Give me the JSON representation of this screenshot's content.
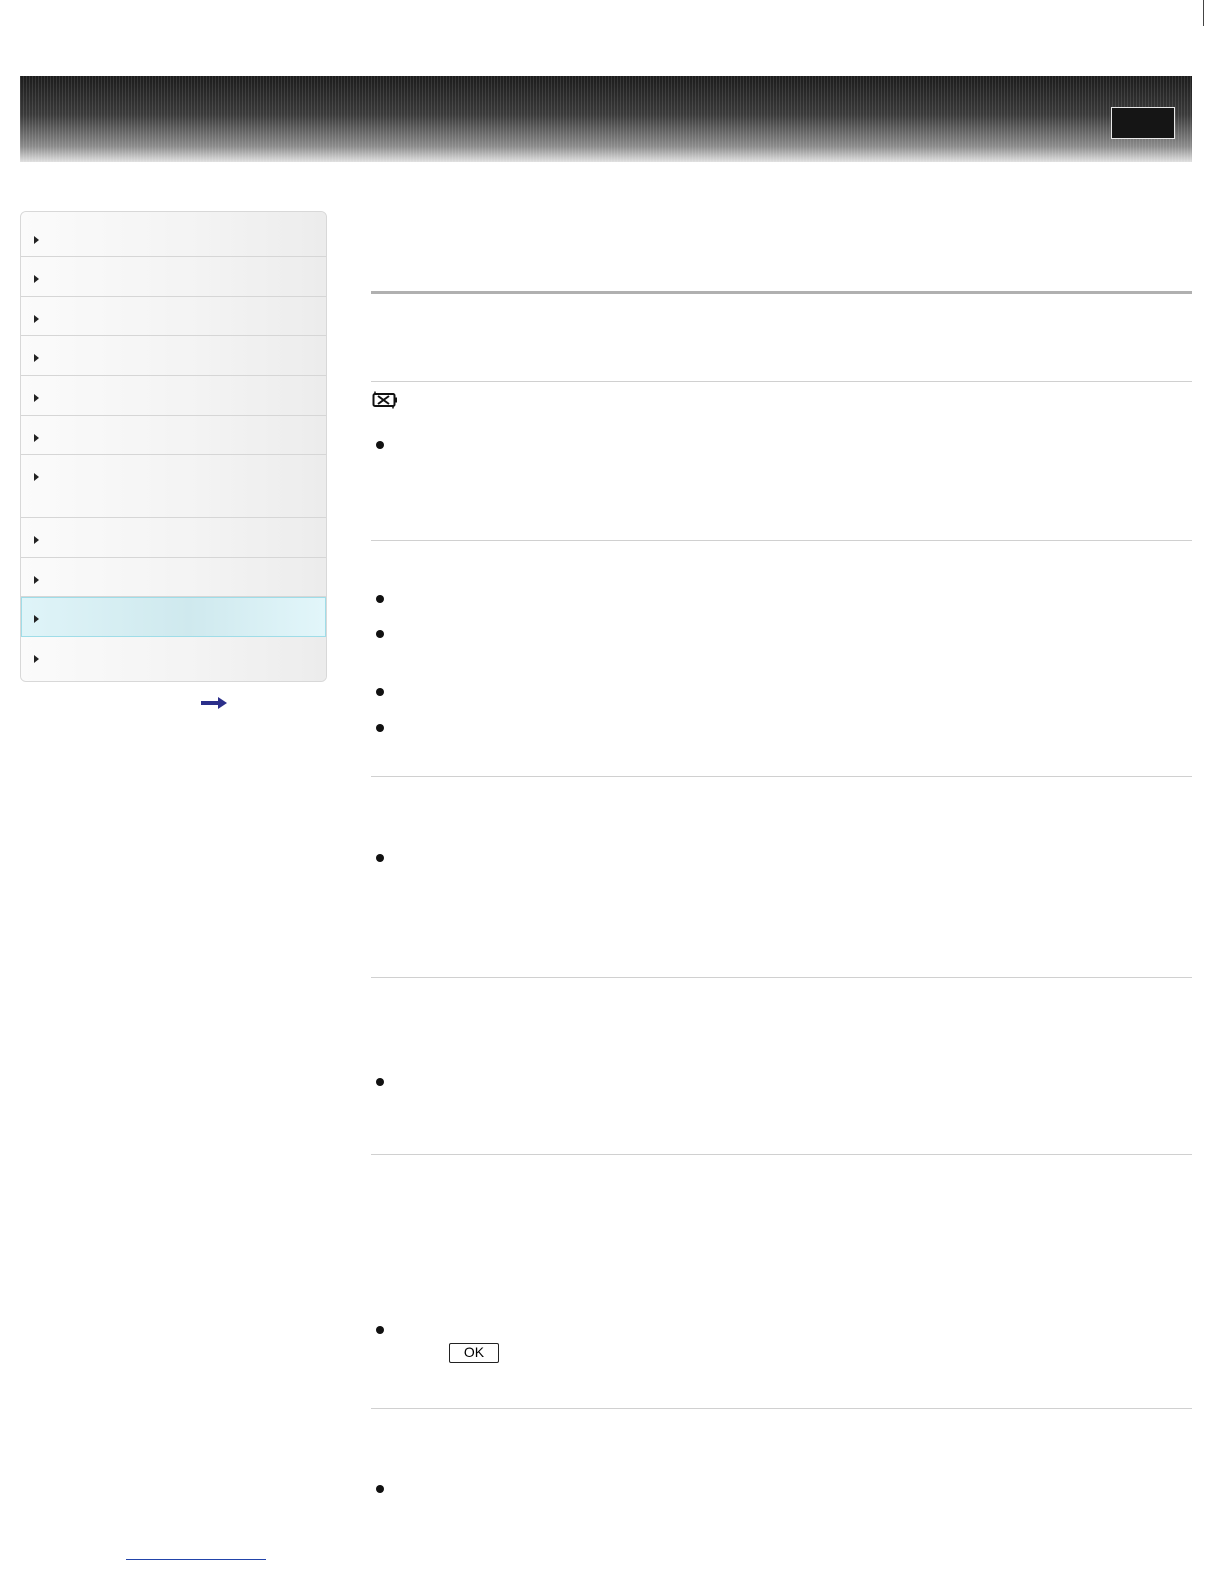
{
  "header": {
    "title": "",
    "top_button_label": ""
  },
  "sidebar": {
    "items": [
      {
        "label": ""
      },
      {
        "label": ""
      },
      {
        "label": ""
      },
      {
        "label": ""
      },
      {
        "label": ""
      },
      {
        "label": ""
      },
      {
        "label": ""
      },
      {
        "label": ""
      },
      {
        "label": ""
      },
      {
        "label": "",
        "active": true
      },
      {
        "label": ""
      }
    ],
    "more_icon": "arrow-right-icon"
  },
  "main": {
    "ok_button_label": "OK",
    "battery_icon": "battery-warning-icon"
  },
  "colors": {
    "banner_dark": "#1c1c1c",
    "active_nav": "#cfe9ee",
    "active_border": "#9fdde8",
    "link_underline": "#2244aa"
  }
}
